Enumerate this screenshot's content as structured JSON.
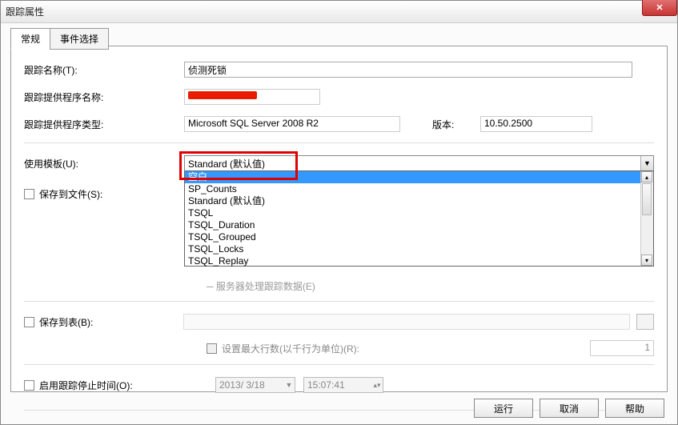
{
  "window": {
    "title": "跟踪属性"
  },
  "tabs": {
    "general": "常规",
    "events": "事件选择"
  },
  "labels": {
    "trace_name": "跟踪名称(T):",
    "provider_name": "跟踪提供程序名称:",
    "provider_type": "跟踪提供程序类型:",
    "version": "版本:",
    "template": "使用模板(U):",
    "save_file": "保存到文件(S):",
    "save_table": "保存到表(B):",
    "set_max_rows": "设置最大行数(以千行为单位)(R):",
    "enable_stop": "启用跟踪停止时间(O):",
    "server_hint": "─ 服务器处理跟踪数据(E)"
  },
  "values": {
    "trace_name": "侦测死锁",
    "provider_type": "Microsoft SQL Server 2008 R2",
    "version": "10.50.2500",
    "template_selected": "Standard (默认值)",
    "max_rows": "1",
    "stop_date": "2013/ 3/18",
    "stop_time": "15:07:41"
  },
  "template_options": [
    "空白",
    "SP_Counts",
    "Standard (默认值)",
    "TSQL",
    "TSQL_Duration",
    "TSQL_Grouped",
    "TSQL_Locks",
    "TSQL_Replay"
  ],
  "buttons": {
    "run": "运行",
    "cancel": "取消",
    "help": "帮助"
  }
}
